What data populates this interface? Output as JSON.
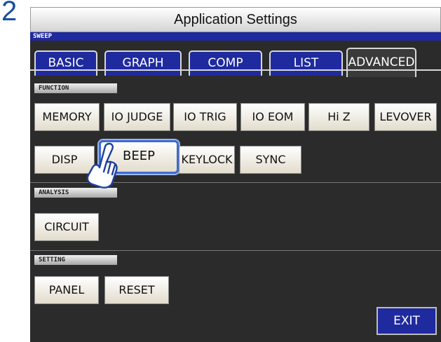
{
  "step_number": "2",
  "title": "Application Settings",
  "sweep_label": "SWEEP",
  "tabs": [
    {
      "label": "BASIC",
      "active": false
    },
    {
      "label": "GRAPH",
      "active": false
    },
    {
      "label": "COMP",
      "active": false
    },
    {
      "label": "LIST",
      "active": false
    },
    {
      "label": "ADVANCED",
      "active": true
    }
  ],
  "sections": {
    "function": {
      "label": "FUNCTION",
      "buttons": [
        "MEMORY",
        "IO JUDGE",
        "IO TRIG",
        "IO EOM",
        "Hi Z",
        "LEVOVER",
        "DISP",
        "BEEP",
        "KEYLOCK",
        "SYNC"
      ]
    },
    "analysis": {
      "label": "ANALYSIS",
      "buttons": [
        "CIRCUIT"
      ]
    },
    "setting": {
      "label": "SETTING",
      "buttons": [
        "PANEL",
        "RESET"
      ]
    }
  },
  "exit_label": "EXIT",
  "highlighted_button": "BEEP",
  "colors": {
    "accent": "#1f2a9e",
    "screen_bg": "#2b2b2b",
    "highlight_border": "#3f6ccf",
    "step_number": "#1a4fa0"
  },
  "icons": {
    "pointer": "pointing-hand-icon"
  }
}
